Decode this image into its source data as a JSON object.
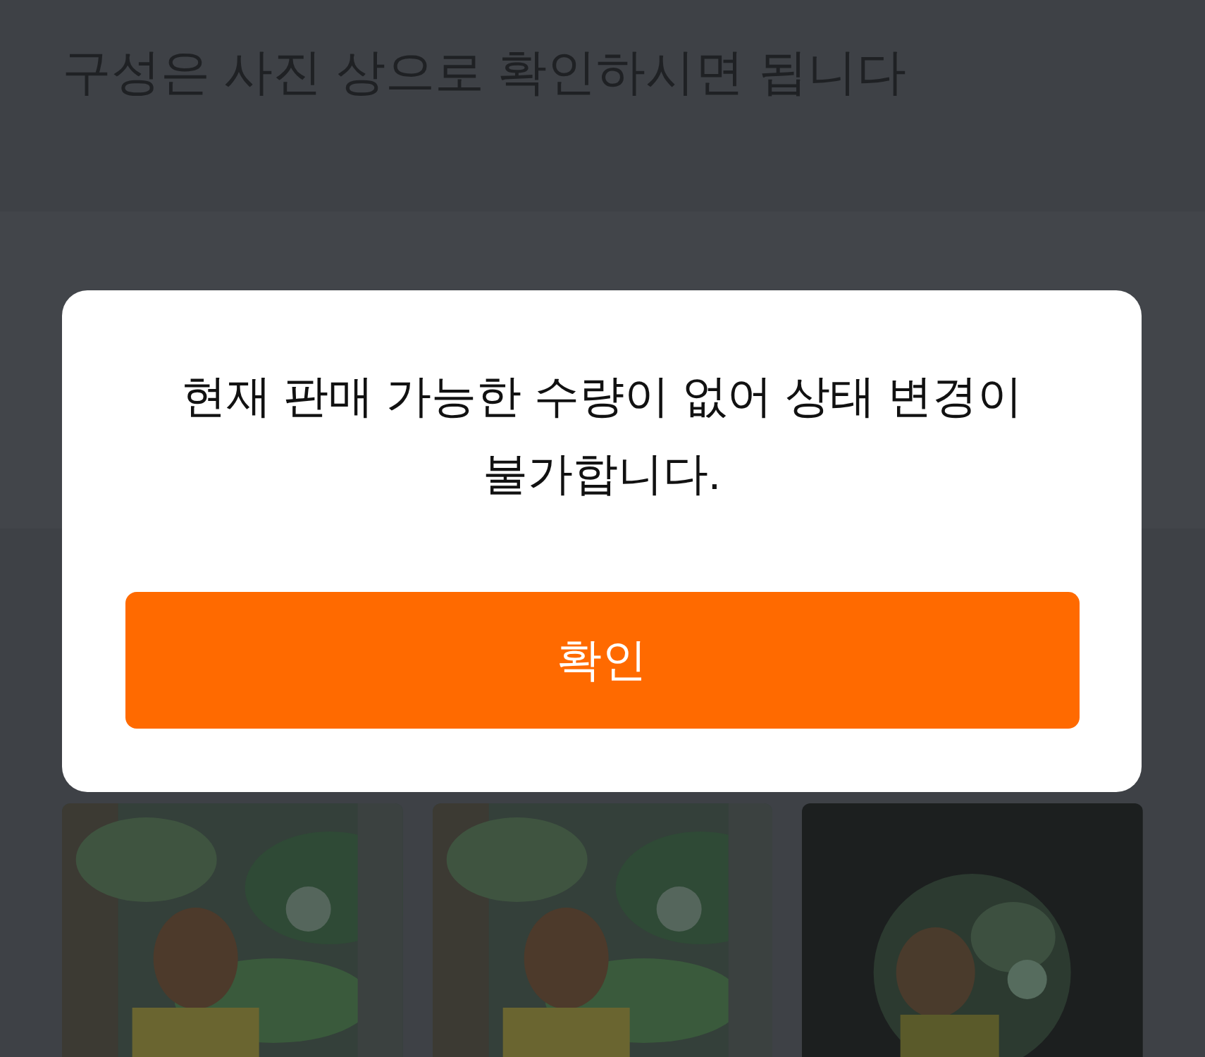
{
  "page": {
    "caption": "구성은 사진 상으로 확인하시면 됩니다"
  },
  "dialog": {
    "message": "현재 판매 가능한 수량이 없어 상태 변경이 불가합니다.",
    "button": "확인"
  }
}
